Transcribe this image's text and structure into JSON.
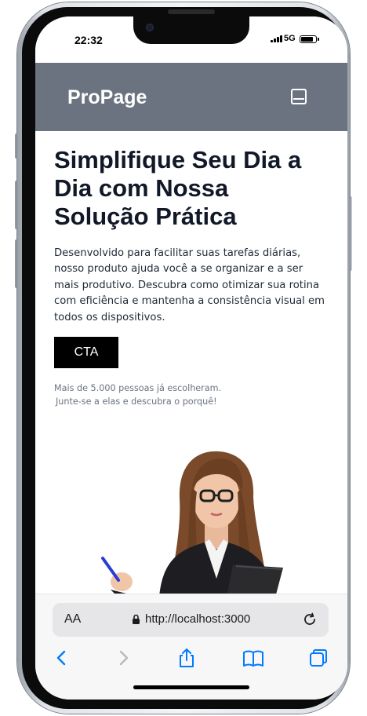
{
  "status_bar": {
    "time": "22:32",
    "network": "5G"
  },
  "header": {
    "brand": "ProPage",
    "menu_icon": "menu-icon",
    "background_color": "#6b7280"
  },
  "hero": {
    "title": "Simplifique Seu Dia a Dia com Nossa Solução Prática",
    "description": "Desenvolvido para facilitar suas tarefas diárias, nosso produto ajuda você a se organizar e a ser mais produtivo. Descubra como otimizar sua rotina com eficiência e mantenha a consistência visual em todos os dispositivos.",
    "cta_label": "CTA",
    "social_proof_line1": "Mais de 5.000 pessoas já escolheram.",
    "social_proof_line2": "Junte-se a elas e descubra o porquê!"
  },
  "browser": {
    "text_size_label": "AA",
    "url": "http://localhost:3000",
    "icons": [
      "back-icon",
      "forward-icon",
      "share-icon",
      "bookmarks-icon",
      "tabs-icon",
      "reload-icon",
      "lock-icon"
    ],
    "accent_color": "#007aff"
  }
}
